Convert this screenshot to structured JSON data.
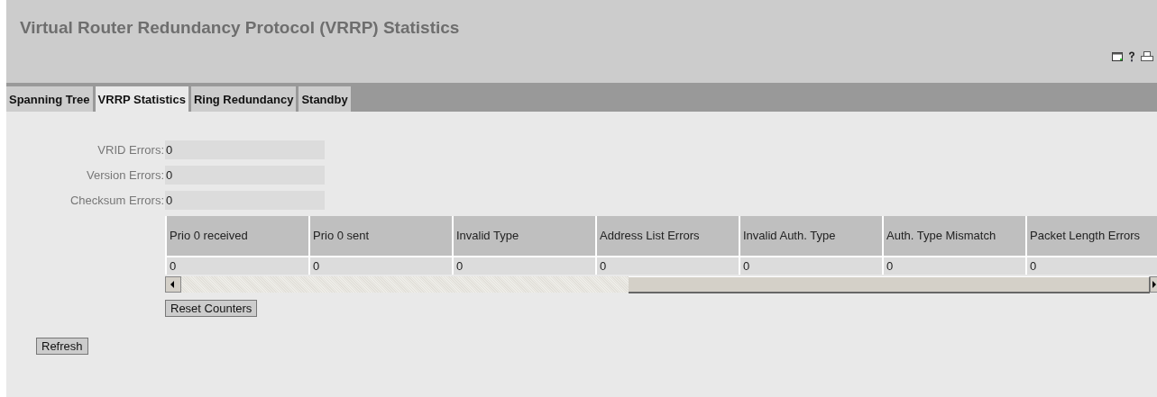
{
  "window": {
    "title": "Virtual Router Redundancy Protocol (VRRP) Statistics"
  },
  "tabs": [
    {
      "label": "Spanning Tree",
      "selected": false
    },
    {
      "label": "VRRP Statistics",
      "selected": true
    },
    {
      "label": "Ring Redundancy",
      "selected": false
    },
    {
      "label": "Standby",
      "selected": false
    }
  ],
  "fields": [
    {
      "label": "VRID Errors:",
      "value": "0"
    },
    {
      "label": "Version Errors:",
      "value": "0"
    },
    {
      "label": "Checksum Errors:",
      "value": "0"
    }
  ],
  "table": {
    "columns": [
      "Prio 0 received",
      "Prio 0 sent",
      "Invalid Type",
      "Address List Errors",
      "Invalid Auth. Type",
      "Auth. Type Mismatch",
      "Packet Length Errors"
    ],
    "rows": [
      [
        "0",
        "0",
        "0",
        "0",
        "0",
        "0",
        "0"
      ]
    ]
  },
  "reset_button": "Reset Counters",
  "refresh_button": "Refresh"
}
